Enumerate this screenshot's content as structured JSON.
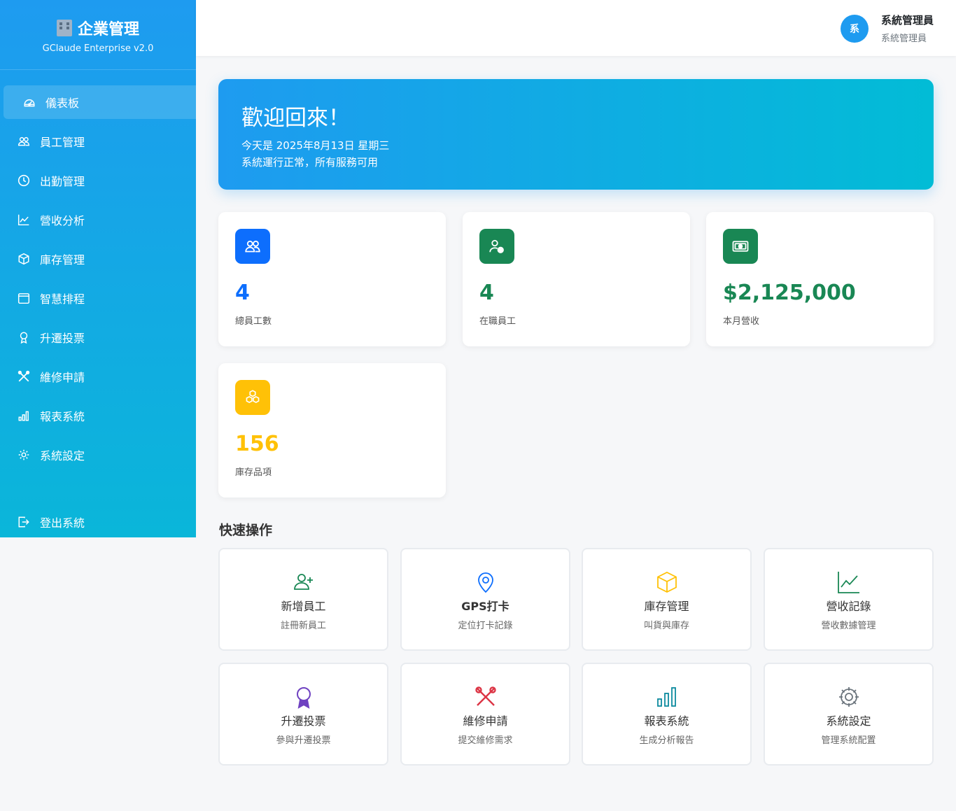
{
  "brand": {
    "title": "企業管理",
    "subtitle": "GClaude Enterprise v2.0",
    "icon": "building-icon"
  },
  "sidebar": {
    "items": [
      {
        "label": "儀表板",
        "icon": "dashboard-icon",
        "active": true
      },
      {
        "label": "員工管理",
        "icon": "people-icon"
      },
      {
        "label": "出勤管理",
        "icon": "clock-icon"
      },
      {
        "label": "營收分析",
        "icon": "line-chart-icon"
      },
      {
        "label": "庫存管理",
        "icon": "box-icon"
      },
      {
        "label": "智慧排程",
        "icon": "calendar-icon"
      },
      {
        "label": "升遷投票",
        "icon": "award-icon"
      },
      {
        "label": "維修申請",
        "icon": "tools-icon"
      },
      {
        "label": "報表系統",
        "icon": "bar-chart-icon"
      },
      {
        "label": "系統設定",
        "icon": "gear-icon"
      }
    ],
    "logout": {
      "label": "登出系統",
      "icon": "logout-icon"
    }
  },
  "header": {
    "user": {
      "avatar_initial": "系",
      "name": "系統管理員",
      "role": "系統管理員"
    }
  },
  "welcome": {
    "title": "歡迎回來！",
    "date_line": "今天是 2025年8月13日 星期三",
    "status_line": "系統運行正常，所有服務可用"
  },
  "stats": [
    {
      "value": "4",
      "label": "總員工數",
      "color": "#0d6efd",
      "icon": "people-icon"
    },
    {
      "value": "4",
      "label": "在職員工",
      "color": "#198754",
      "icon": "person-check-icon"
    },
    {
      "value": "$2,125,000",
      "label": "本月營收",
      "color": "#198754",
      "icon": "cash-icon"
    },
    {
      "value": "156",
      "label": "庫存品項",
      "color": "#ffc107",
      "icon": "boxes-icon"
    }
  ],
  "quick_actions": {
    "title": "快速操作",
    "items": [
      {
        "title": "新增員工",
        "subtitle": "註冊新員工",
        "icon": "person-plus-icon",
        "color": "#198754"
      },
      {
        "title": "GPS打卡",
        "subtitle": "定位打卡記錄",
        "icon": "location-pin-icon",
        "color": "#0d6efd"
      },
      {
        "title": "庫存管理",
        "subtitle": "叫貨與庫存",
        "icon": "box-icon",
        "color": "#ffc107"
      },
      {
        "title": "營收記錄",
        "subtitle": "營收數據管理",
        "icon": "line-chart-icon",
        "color": "#198754"
      },
      {
        "title": "升遷投票",
        "subtitle": "參與升遷投票",
        "icon": "award-icon",
        "color": "#6f42c1"
      },
      {
        "title": "維修申請",
        "subtitle": "提交維修需求",
        "icon": "tools-icon",
        "color": "#dc3545"
      },
      {
        "title": "報表系統",
        "subtitle": "生成分析報告",
        "icon": "bar-chart-icon",
        "color": "#0d8a9e"
      },
      {
        "title": "系統設定",
        "subtitle": "管理系統配置",
        "icon": "gear-icon",
        "color": "#6c757d"
      }
    ]
  }
}
